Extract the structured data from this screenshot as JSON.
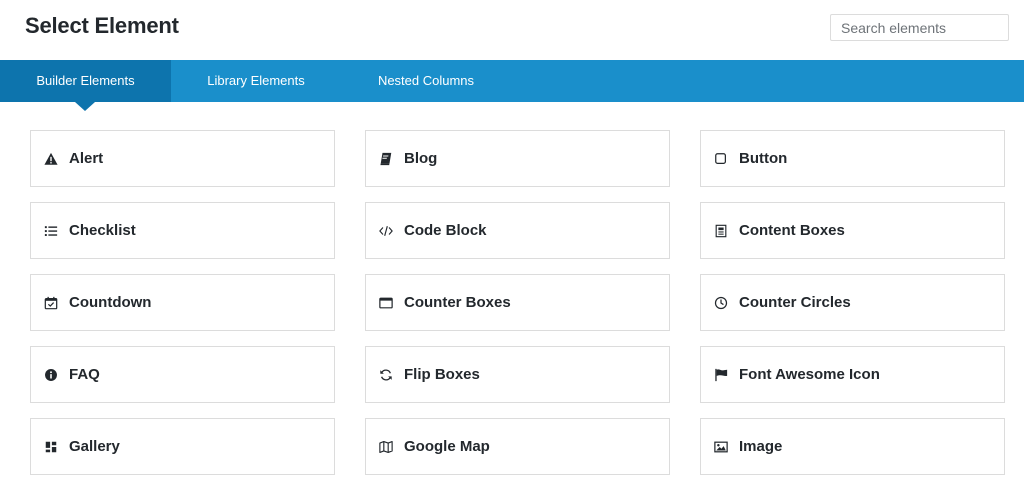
{
  "header": {
    "title": "Select Element",
    "search_placeholder": "Search elements"
  },
  "tabs": [
    {
      "label": "Builder Elements",
      "active": true
    },
    {
      "label": "Library Elements",
      "active": false
    },
    {
      "label": "Nested Columns",
      "active": false
    }
  ],
  "elements": [
    {
      "label": "Alert",
      "icon": "warning-icon"
    },
    {
      "label": "Blog",
      "icon": "book-icon"
    },
    {
      "label": "Button",
      "icon": "square-icon"
    },
    {
      "label": "Checklist",
      "icon": "list-icon"
    },
    {
      "label": "Code Block",
      "icon": "code-icon"
    },
    {
      "label": "Content Boxes",
      "icon": "content-box-icon"
    },
    {
      "label": "Countdown",
      "icon": "calendar-check-icon"
    },
    {
      "label": "Counter Boxes",
      "icon": "window-icon"
    },
    {
      "label": "Counter Circles",
      "icon": "clock-icon"
    },
    {
      "label": "FAQ",
      "icon": "info-icon"
    },
    {
      "label": "Flip Boxes",
      "icon": "sync-icon"
    },
    {
      "label": "Font Awesome Icon",
      "icon": "flag-icon"
    },
    {
      "label": "Gallery",
      "icon": "gallery-icon"
    },
    {
      "label": "Google Map",
      "icon": "map-icon"
    },
    {
      "label": "Image",
      "icon": "image-icon"
    }
  ],
  "colors": {
    "tab_bar": "#1a8fcb",
    "tab_active": "#0d74ad",
    "card_border": "#dcdcdc",
    "text": "#23282d"
  }
}
